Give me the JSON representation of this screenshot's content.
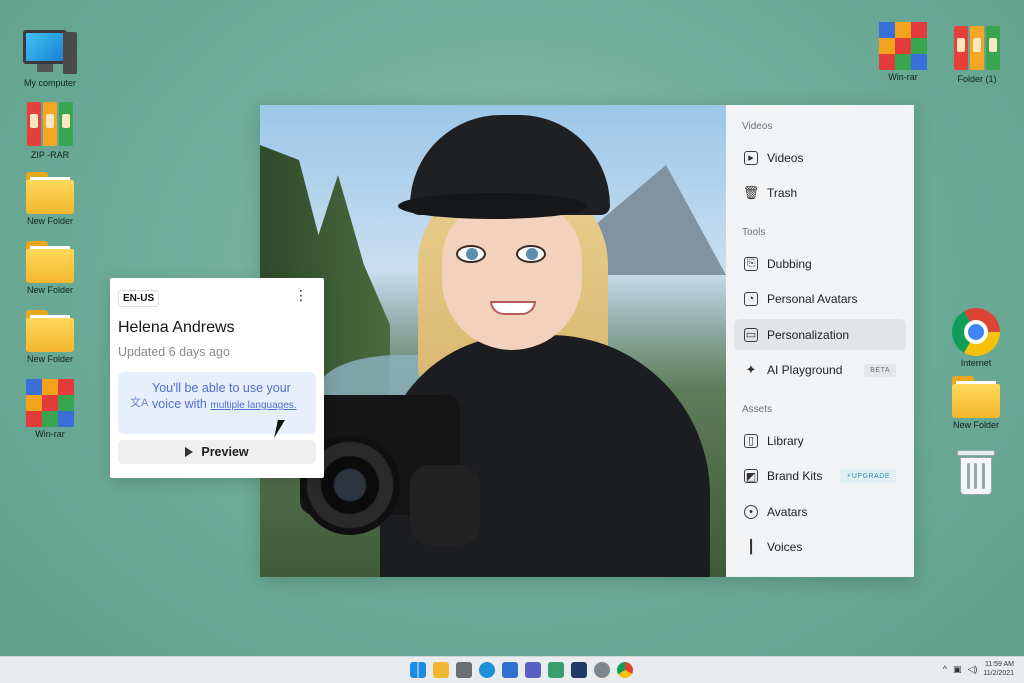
{
  "desktop_left": [
    {
      "label": "My computer",
      "icon": "computer-icon"
    },
    {
      "label": "ZIP -RAR",
      "icon": "binders-icon"
    },
    {
      "label": "New Folder",
      "icon": "folder-icon"
    },
    {
      "label": "New Folder",
      "icon": "folder-icon"
    },
    {
      "label": "New Folder",
      "icon": "folder-icon"
    },
    {
      "label": "Win-rar",
      "icon": "winrar-icon"
    }
  ],
  "desktop_top_right": [
    {
      "label": "Win-rar",
      "icon": "winrar-icon"
    },
    {
      "label": "Folder (1)",
      "icon": "binders-icon"
    }
  ],
  "desktop_right": [
    {
      "label": "Internet",
      "icon": "chrome-icon"
    },
    {
      "label": "New Folder",
      "icon": "folder-icon"
    },
    {
      "label": "",
      "icon": "trash-icon"
    }
  ],
  "sidebar": {
    "sections": [
      {
        "title": "Videos",
        "items": [
          {
            "label": "Videos",
            "icon": "video-file-icon"
          },
          {
            "label": "Trash",
            "icon": "trash-icon"
          }
        ]
      },
      {
        "title": "Tools",
        "items": [
          {
            "label": "Dubbing",
            "icon": "dubbing-icon"
          },
          {
            "label": "Personal Avatars",
            "icon": "person-icon"
          },
          {
            "label": "Personalization",
            "icon": "personalization-icon",
            "active": true
          },
          {
            "label": "AI Playground",
            "icon": "sparkle-icon",
            "badge": "BETA"
          }
        ]
      },
      {
        "title": "Assets",
        "items": [
          {
            "label": "Library",
            "icon": "book-icon"
          },
          {
            "label": "Brand Kits",
            "icon": "brand-kit-icon",
            "badge": "UPGRADE"
          },
          {
            "label": "Avatars",
            "icon": "avatar-icon"
          },
          {
            "label": "Voices",
            "icon": "waveform-icon"
          }
        ]
      }
    ]
  },
  "voice_card": {
    "language": "EN-US",
    "name": "Helena Andrews",
    "updated": "Updated 6 days ago",
    "info_text": "You'll be able to use your voice with",
    "info_link": "multiple languages.",
    "preview_label": "Preview"
  },
  "taskbar": {
    "time": "11:59 AM",
    "date": "11/2/2021"
  },
  "colors": {
    "desktop_bg": "#6fae9a",
    "panel_bg": "#f2f3f4",
    "info_bg": "#e7eefc",
    "info_text": "#4f6fcf"
  }
}
